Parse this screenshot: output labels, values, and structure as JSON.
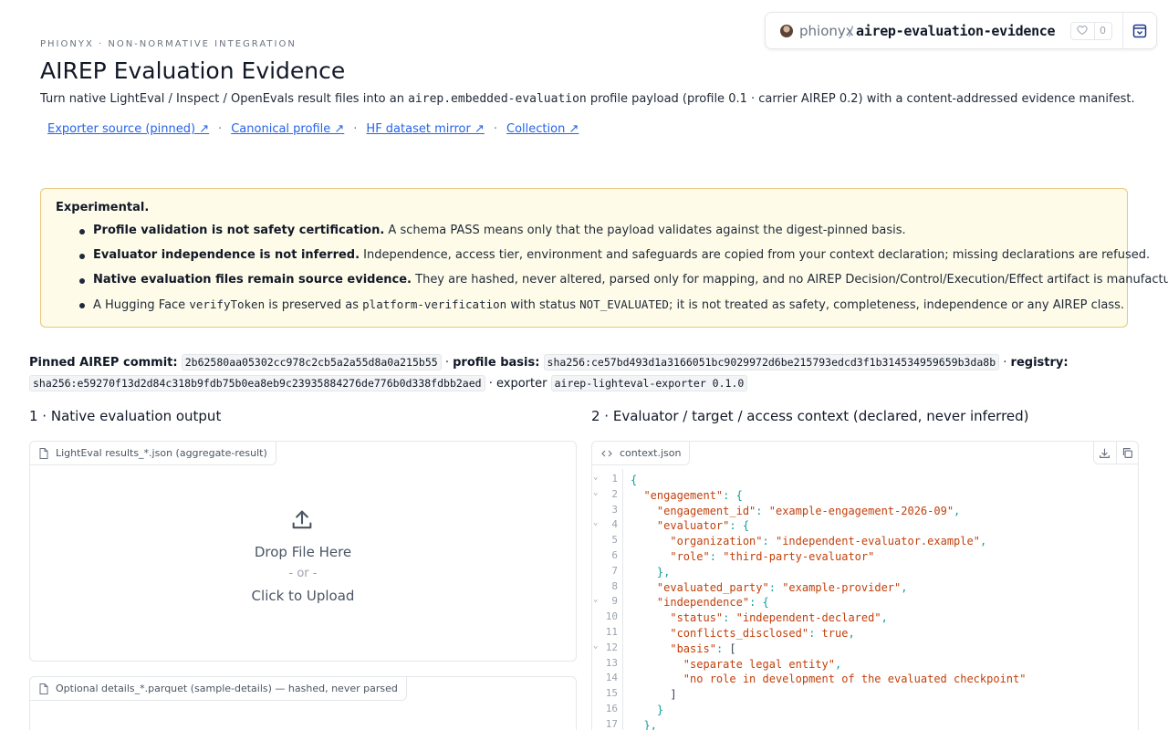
{
  "space": {
    "owner": "phionyx",
    "repo": "airep-evaluation-evidence",
    "likes": "0"
  },
  "header": {
    "eyebrow": "PHIONYX · NON-NORMATIVE INTEGRATION",
    "title": "AIREP Evaluation Evidence",
    "subtitle_pre": "Turn native LightEval / Inspect / OpenEvals result files into an ",
    "subtitle_code": "airep.embedded-evaluation",
    "subtitle_post": " profile payload (profile 0.1 · carrier AIREP 0.2) with a content-addressed evidence manifest.",
    "links": [
      "Exporter source (pinned) ↗",
      "Canonical profile ↗",
      "HF dataset mirror ↗",
      "Collection ↗"
    ],
    "link_sep": "·"
  },
  "warning": {
    "title": "Experimental.",
    "items": [
      {
        "bold": "Profile validation is not safety certification.",
        "text": " A schema PASS means only that the payload validates against the digest-pinned basis."
      },
      {
        "bold": "Evaluator independence is not inferred.",
        "text": " Independence, access tier, environment and safeguards are copied from your context declaration; missing declarations are refused."
      },
      {
        "bold": "Native evaluation files remain source evidence.",
        "text": " They are hashed, never altered, parsed only for mapping, and no AIREP Decision/Control/Execution/Effect artifact is manufactured."
      }
    ],
    "last": {
      "t1": "A Hugging Face ",
      "c1": "verifyToken",
      "t2": " is preserved as ",
      "c2": "platform-verification",
      "t3": " with status ",
      "c3": "NOT_EVALUATED",
      "t4": "; it is not treated as safety, completeness, independence or any AIREP class."
    }
  },
  "pinned": {
    "commit_label": "Pinned AIREP commit:",
    "commit": "2b62580aa05302cc978c2cb5a2a55d8a0a215b55",
    "sep": "·",
    "basis_label": "profile basis:",
    "basis": "sha256:ce57bd493d1a3166051bc9029972d6be215793edcd3f1b314534959659b3da8b",
    "registry_label": "registry:",
    "registry": "sha256:e59270f13d2d84c318b9fdb75b0ea8eb9c23935884276de776b0d338fdbb2aed",
    "exporter_label": "exporter",
    "exporter": "airep-lighteval-exporter 0.1.0"
  },
  "section1": {
    "heading": "1 · Native evaluation output",
    "upload_label": "LightEval results_*.json (aggregate-result)",
    "drop": "Drop File Here",
    "or": "- or -",
    "click": "Click to Upload",
    "details_label": "Optional details_*.parquet (sample-details) — hashed, never parsed"
  },
  "section2": {
    "heading": "2 · Evaluator / target / access context (declared, never inferred)",
    "file_label": "context.json",
    "line_numbers": [
      "1",
      "2",
      "3",
      "4",
      "5",
      "6",
      "7",
      "8",
      "9",
      "10",
      "11",
      "12",
      "13",
      "14",
      "15",
      "16",
      "17"
    ],
    "lines": [
      "{",
      "  \"engagement\": {",
      "    \"engagement_id\": \"example-engagement-2026-09\",",
      "    \"evaluator\": {",
      "      \"organization\": \"independent-evaluator.example\",",
      "      \"role\": \"third-party-evaluator\"",
      "    },",
      "    \"evaluated_party\": \"example-provider\",",
      "    \"independence\": {",
      "      \"status\": \"independent-declared\",",
      "      \"conflicts_disclosed\": true,",
      "      \"basis\": [",
      "        \"separate legal entity\",",
      "        \"no role in development of the evaluated checkpoint\"",
      "      ]",
      "    }",
      "  },"
    ]
  }
}
